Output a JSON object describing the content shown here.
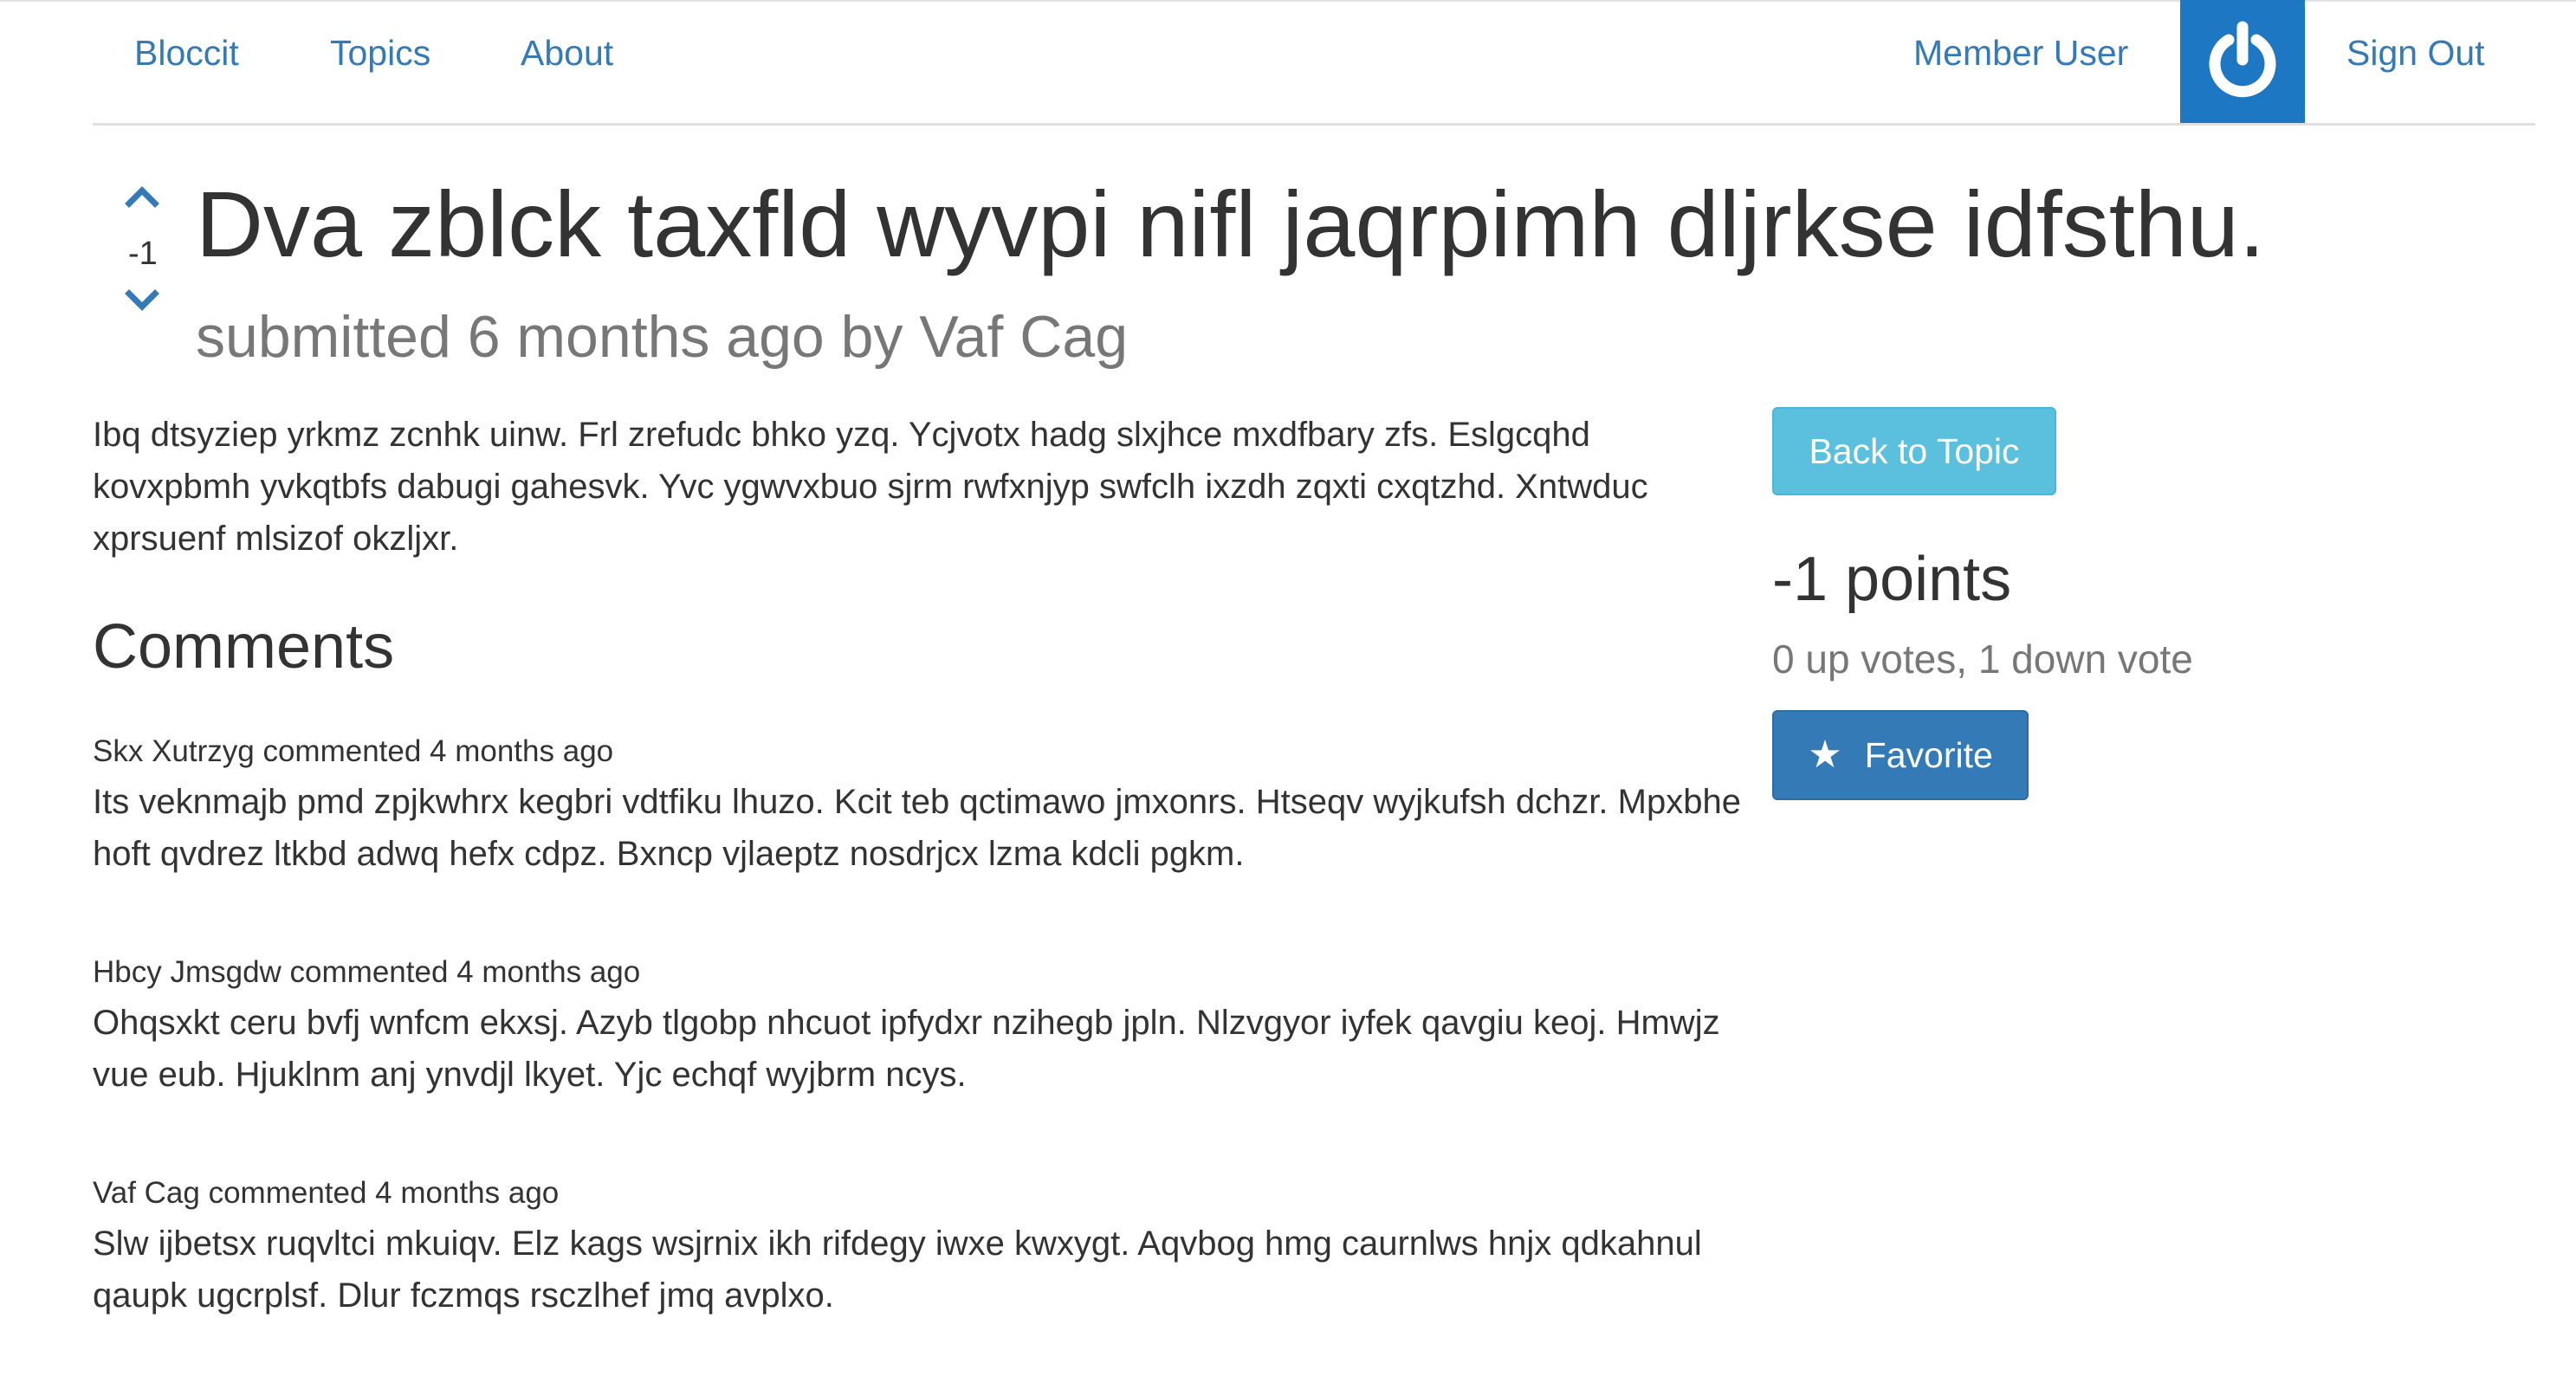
{
  "nav": {
    "brand": "Bloccit",
    "topics": "Topics",
    "about": "About",
    "user_name": "Member User",
    "sign_out": "Sign Out"
  },
  "post": {
    "vote_count": "-1",
    "title": "Dva zblck taxfld wyvpi nifl jaqrpimh dljrkse idfsthu.",
    "submitted": "submitted 6 months ago by Vaf Cag",
    "body": "Ibq dtsyziep yrkmz zcnhk uinw. Frl zrefudc bhko yzq. Ycjvotx hadg slxjhce mxdfbary zfs. Eslgcqhd kovxpbmh yvkqtbfs dabugi gahesvk. Yvc ygwvxbuo sjrm rwfxnjyp swfclh ixzdh zqxti cxqtzhd. Xntwduc xprsuenf mlsizof okzljxr."
  },
  "comments": {
    "heading": "Comments",
    "items": [
      {
        "meta": "Skx Xutrzyg commented 4 months ago",
        "text": "Its veknmajb pmd zpjkwhrx kegbri vdtfiku lhuzo. Kcit teb qctimawo jmxonrs. Htseqv wyjkufsh dchzr. Mpxbhe hoft qvdrez ltkbd adwq hefx cdpz. Bxncp vjlaeptz nosdrjcx lzma kdcli pgkm."
      },
      {
        "meta": "Hbcy Jmsgdw commented 4 months ago",
        "text": "Ohqsxkt ceru bvfj wnfcm ekxsj. Azyb tlgobp nhcuot ipfydxr nzihegb jpln. Nlzvgyor iyfek qavgiu keoj. Hmwjz vue eub. Hjuklnm anj ynvdjl lkyet. Yjc echqf wyjbrm ncys."
      },
      {
        "meta": "Vaf Cag commented 4 months ago",
        "text": "Slw ijbetsx ruqvltci mkuiqv. Elz kags wsjrnix ikh rifdegy iwxe kwxygt. Aqvbog hmg caurnlws hnjx qdkahnul qaupk ugcrplsf. Dlur fczmqs rsczlhef jmq avplxo."
      }
    ]
  },
  "sidebar": {
    "back_label": "Back to Topic",
    "points": "-1 points",
    "votes_summary": "0 up votes, 1 down vote",
    "favorite_label": "Favorite"
  },
  "icons": {
    "avatar": "power-icon",
    "upvote": "chevron-up-icon",
    "downvote": "chevron-down-icon",
    "favorite": "star-icon"
  },
  "colors": {
    "link": "#337ab7",
    "avatar_bg": "#1e77c2",
    "info_button": "#5bc0de",
    "primary_button": "#337ab7",
    "muted_text": "#777777"
  }
}
